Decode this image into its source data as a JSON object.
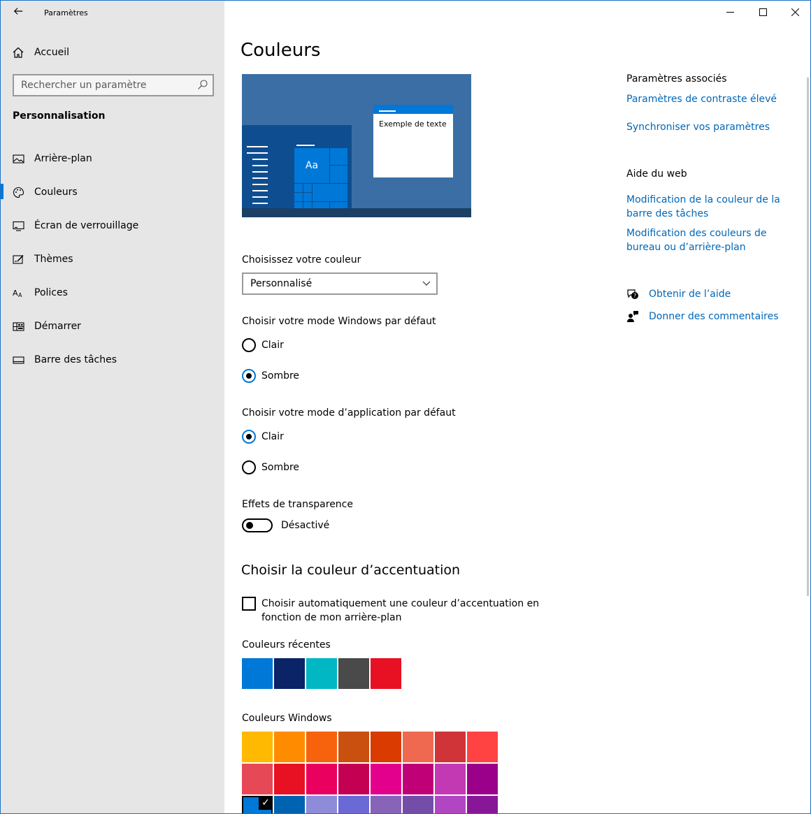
{
  "window": {
    "title": "Paramètres"
  },
  "sidebar": {
    "home_label": "Accueil",
    "search_placeholder": "Rechercher un paramètre",
    "section_title": "Personnalisation",
    "items": [
      {
        "label": "Arrière-plan",
        "icon": "picture-icon"
      },
      {
        "label": "Couleurs",
        "icon": "palette-icon",
        "active": true
      },
      {
        "label": "Écran de verrouillage",
        "icon": "lock-screen-icon"
      },
      {
        "label": "Thèmes",
        "icon": "themes-icon"
      },
      {
        "label": "Polices",
        "icon": "fonts-icon"
      },
      {
        "label": "Démarrer",
        "icon": "start-icon"
      },
      {
        "label": "Barre des tâches",
        "icon": "taskbar-icon"
      }
    ]
  },
  "main": {
    "title": "Couleurs",
    "preview": {
      "tile_text": "Aa",
      "window_text": "Exemple de texte"
    },
    "choose_color_label": "Choisissez votre couleur",
    "choose_color_value": "Personnalisé",
    "windows_mode": {
      "label": "Choisir votre mode Windows par défaut",
      "options": [
        "Clair",
        "Sombre"
      ],
      "selected": "Sombre"
    },
    "app_mode": {
      "label": "Choisir votre mode d’application par défaut",
      "options": [
        "Clair",
        "Sombre"
      ],
      "selected": "Clair"
    },
    "transparency": {
      "label": "Effets de transparence",
      "state": "Désactivé"
    },
    "accent_title": "Choisir la couleur d’accentuation",
    "auto_accent_label": "Choisir automatiquement une couleur d’accentuation en fonction de mon arrière-plan",
    "recent_label": "Couleurs récentes",
    "recent_colors": [
      "#0078d7",
      "#0b2468",
      "#00b7c3",
      "#4a4a4a",
      "#e81123"
    ],
    "windows_colors_label": "Couleurs Windows",
    "windows_colors": [
      [
        "#ffb900",
        "#ff8c00",
        "#f7630c",
        "#ca5010",
        "#da3b01",
        "#ef6950",
        "#d13438",
        "#ff4343"
      ],
      [
        "#e74856",
        "#e81123",
        "#ea005e",
        "#c30052",
        "#e3008c",
        "#bf0077",
        "#c239b3",
        "#9a0089"
      ],
      [
        "#0078d7",
        "#0063b1",
        "#8e8cd8",
        "#6b69d6",
        "#8764b8",
        "#744da9",
        "#b146c2",
        "#881798"
      ]
    ],
    "selected_swatch_check": "✓"
  },
  "related": {
    "title": "Paramètres associés",
    "links": [
      "Paramètres de contraste élevé",
      "Synchroniser vos paramètres"
    ]
  },
  "web_help": {
    "title": "Aide du web",
    "links": [
      "Modification de la couleur de la barre des tâches",
      "Modification des couleurs de bureau ou d’arrière-plan"
    ]
  },
  "support": {
    "get_help": "Obtenir de l’aide",
    "feedback": "Donner des commentaires"
  }
}
